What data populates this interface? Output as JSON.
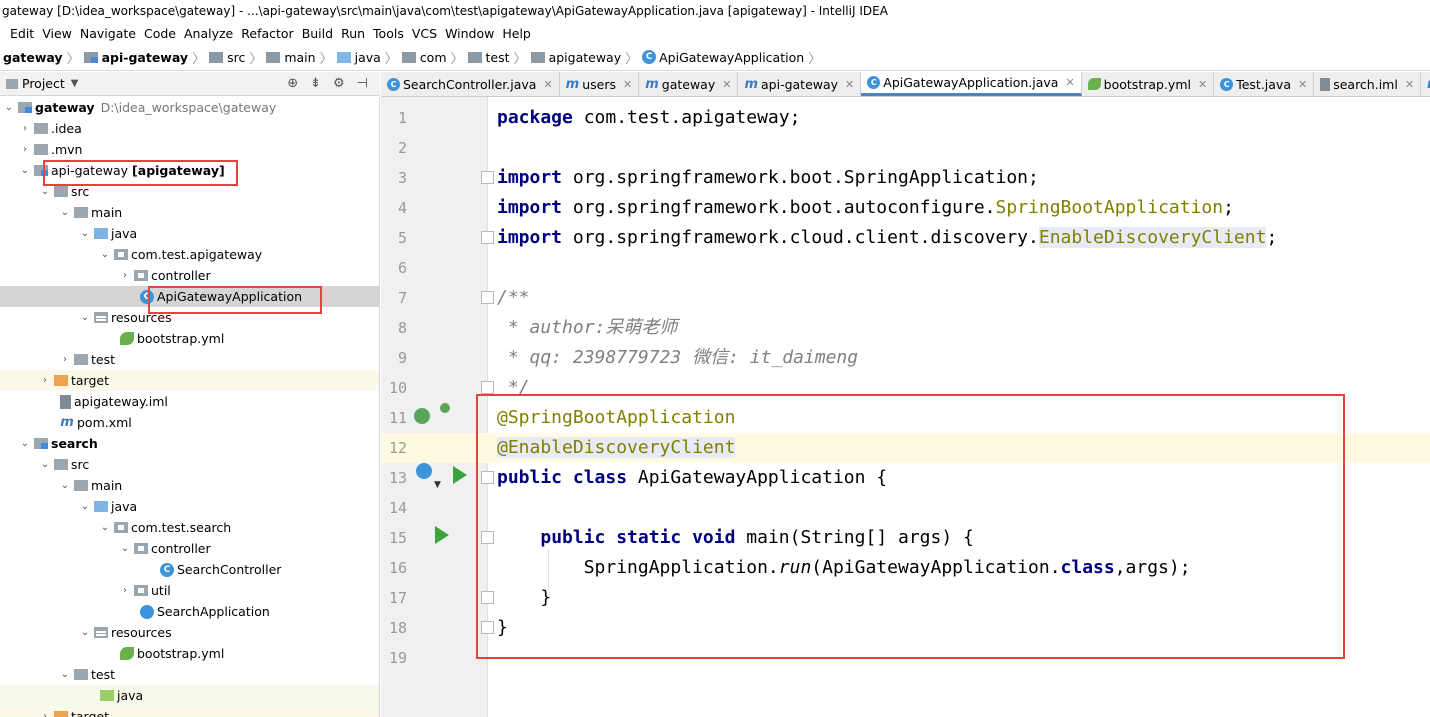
{
  "window": {
    "title": "gateway [D:\\idea_workspace\\gateway] - ...\\api-gateway\\src\\main\\java\\com\\test\\apigateway\\ApiGatewayApplication.java [apigateway] - IntelliJ IDEA"
  },
  "menu": [
    "Edit",
    "View",
    "Navigate",
    "Code",
    "Analyze",
    "Refactor",
    "Build",
    "Run",
    "Tools",
    "VCS",
    "Window",
    "Help"
  ],
  "breadcrumb": [
    "gateway",
    "api-gateway",
    "src",
    "main",
    "java",
    "com",
    "test",
    "apigateway",
    "ApiGatewayApplication"
  ],
  "project_panel": {
    "title": "Project",
    "tree": [
      {
        "label": "gateway",
        "path": "D:\\idea_workspace\\gateway",
        "bold": true
      },
      {
        "label": ".idea"
      },
      {
        "label": ".mvn"
      },
      {
        "label": "api-gateway",
        "suffix": "[apigateway]"
      },
      {
        "label": "src"
      },
      {
        "label": "main"
      },
      {
        "label": "java"
      },
      {
        "label": "com.test.apigateway"
      },
      {
        "label": "controller"
      },
      {
        "label": "ApiGatewayApplication",
        "icon_letter": "C"
      },
      {
        "label": "resources"
      },
      {
        "label": "bootstrap.yml"
      },
      {
        "label": "test"
      },
      {
        "label": "target"
      },
      {
        "label": "apigateway.iml"
      },
      {
        "label": "pom.xml",
        "icon_letter": "m"
      },
      {
        "label": "search",
        "bold": true
      },
      {
        "label": "src"
      },
      {
        "label": "main"
      },
      {
        "label": "java"
      },
      {
        "label": "com.test.search"
      },
      {
        "label": "controller"
      },
      {
        "label": "SearchController",
        "icon_letter": "C"
      },
      {
        "label": "util"
      },
      {
        "label": "SearchApplication"
      },
      {
        "label": "resources"
      },
      {
        "label": "bootstrap.yml"
      },
      {
        "label": "test"
      },
      {
        "label": "java"
      },
      {
        "label": "target"
      }
    ]
  },
  "tabs": [
    {
      "label": "SearchController.java",
      "icon": "C"
    },
    {
      "label": "users",
      "icon": "m"
    },
    {
      "label": "gateway",
      "icon": "m"
    },
    {
      "label": "api-gateway",
      "icon": "m"
    },
    {
      "label": "ApiGatewayApplication.java",
      "icon": "C",
      "active": true
    },
    {
      "label": "bootstrap.yml",
      "icon": "leaf"
    },
    {
      "label": "Test.java",
      "icon": "C"
    },
    {
      "label": "search.iml",
      "icon": "iml"
    },
    {
      "label": "sea",
      "icon": "m"
    }
  ],
  "editor": {
    "line_numbers": [
      "1",
      "2",
      "3",
      "4",
      "5",
      "6",
      "7",
      "8",
      "9",
      "10",
      "11",
      "12",
      "13",
      "14",
      "15",
      "16",
      "17",
      "18",
      "19"
    ],
    "current_line": "12",
    "code": {
      "l1_kw": "package",
      "l1_rest": " com.test.apigateway;",
      "l3_kw": "import",
      "l3_rest": " org.springframework.boot.SpringApplication;",
      "l4_kw": "import",
      "l4_rest": " org.springframework.boot.autoconfigure.",
      "l4_ann": "SpringBootApplication",
      "l4_end": ";",
      "l5_kw": "import",
      "l5_rest": " org.springframework.cloud.client.discovery.",
      "l5_ann": "EnableDiscoveryClient",
      "l5_end": ";",
      "l7": "/**",
      "l8": " * author:呆萌老师",
      "l9": " * qq: 2398779723 微信: it_daimeng",
      "l10": " */",
      "l11": "@SpringBootApplication",
      "l12": "@EnableDiscoveryClient",
      "l13_kw": "public class",
      "l13_rest": " ApiGatewayApplication {",
      "l15_indent": "    ",
      "l15_kw": "public static void",
      "l15_rest": " main(String[] args) {",
      "l16_a": "        SpringApplication.",
      "l16_run": "run",
      "l16_b": "(ApiGatewayApplication.",
      "l16_kw": "class",
      "l16_c": ",args);",
      "l17": "    }",
      "l18": "}"
    }
  },
  "colors": {
    "annotation": "#808000",
    "keyword": "#000080",
    "comment": "#808080",
    "highlight_box": "#e8403f"
  }
}
